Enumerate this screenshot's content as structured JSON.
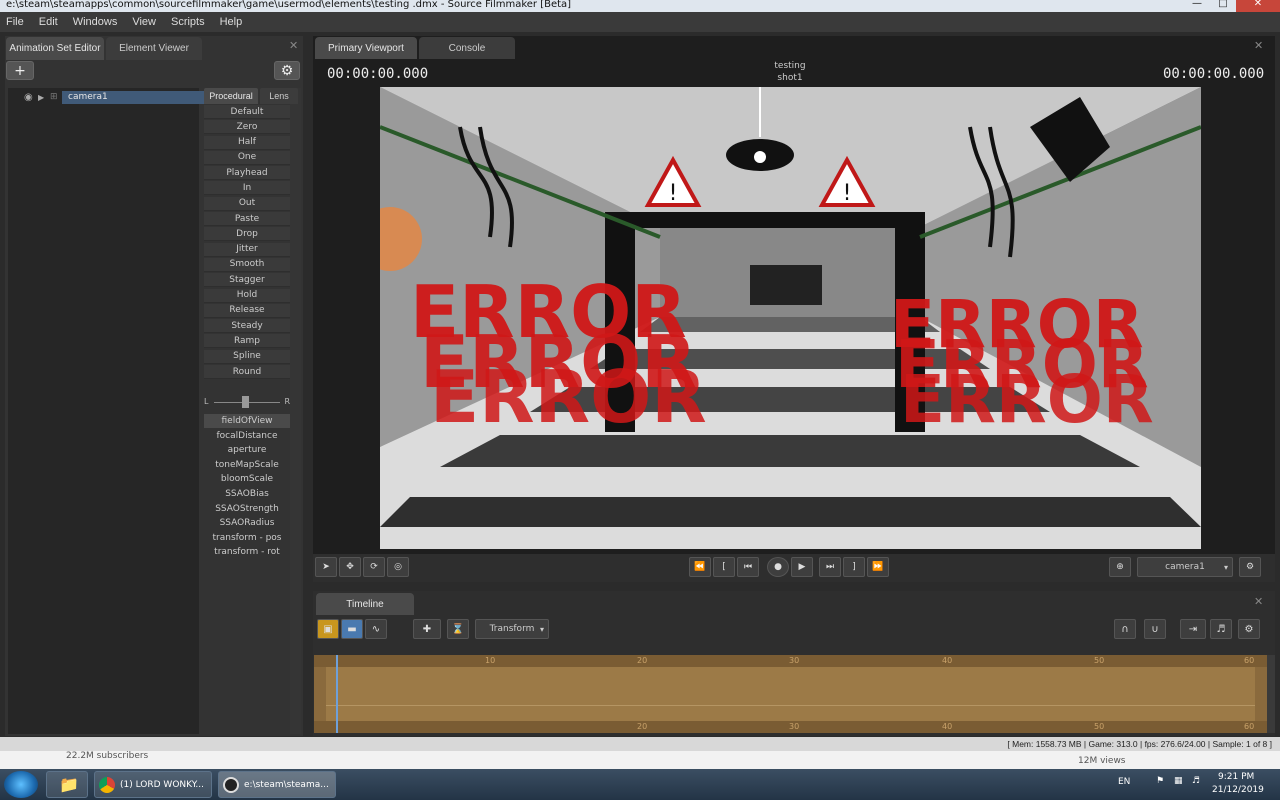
{
  "window": {
    "title": "e:\\steam\\steamapps\\common\\sourcefilmmaker\\game\\usermod\\elements\\testing .dmx - Source Filmmaker [Beta]"
  },
  "menu": [
    "File",
    "Edit",
    "Windows",
    "View",
    "Scripts",
    "Help"
  ],
  "left_panel": {
    "tabs": [
      "Animation Set Editor",
      "Element Viewer"
    ],
    "tree_item": "camera1",
    "proc_tabs": [
      "Procedural",
      "Lens"
    ],
    "procedural_items": [
      "Default",
      "Zero",
      "Half",
      "One",
      "Playhead",
      "In",
      "Out",
      "Paste",
      "Drop",
      "Jitter",
      "Smooth",
      "Stagger",
      "Hold",
      "Release",
      "Steady",
      "Ramp",
      "Spline",
      "Round"
    ],
    "slider_left": "L",
    "slider_right": "R",
    "params": [
      "fieldOfView",
      "focalDistance",
      "aperture",
      "toneMapScale",
      "bloomScale",
      "SSAOBias",
      "SSAOStrength",
      "SSAORadius",
      "transform - pos",
      "transform - rot"
    ]
  },
  "viewport": {
    "tabs": [
      "Primary Viewport",
      "Console"
    ],
    "timecode_left": "00:00:00.000",
    "timecode_right": "00:00:00.000",
    "session": "testing",
    "shot": "shot1",
    "camera_select": "camera1",
    "scene_text": "ERROR"
  },
  "timeline": {
    "tab": "Timeline",
    "mode_select": "Transform",
    "ticks": [
      "10",
      "20",
      "30",
      "40",
      "50",
      "60"
    ]
  },
  "statusbar": {
    "text": "[ Mem:   1558.73 MB  |  Game:      313.0  |  fps:  276.6/24.00  |  Sample:               1 of 8 ]"
  },
  "behind_window": {
    "subscribers": "22.2M subscribers",
    "views": "12M views"
  },
  "taskbar": {
    "items": [
      "(1) LORD WONKY...",
      "e:\\steam\\steama..."
    ],
    "lang": "EN",
    "time": "9:21 PM",
    "date": "21/12/2019"
  },
  "colors": {
    "accent": "#405a78",
    "timeline": "#9c7a47",
    "error_text": "#d01818"
  }
}
